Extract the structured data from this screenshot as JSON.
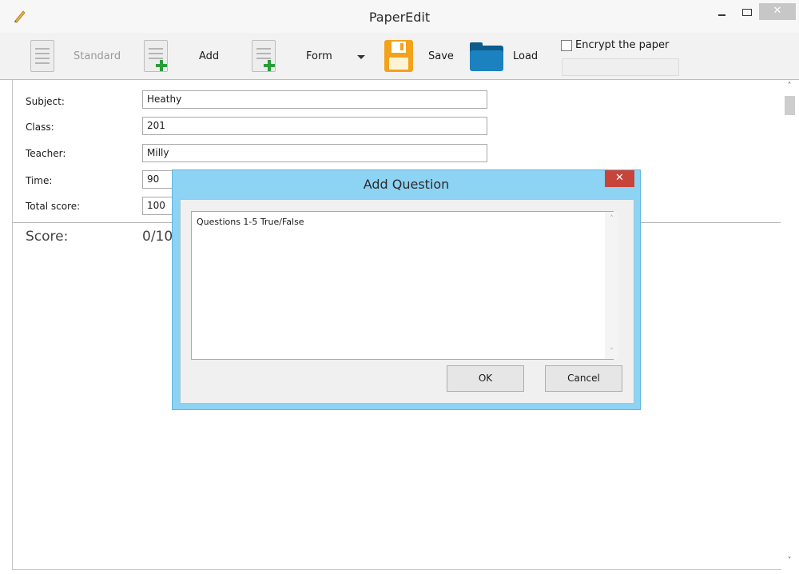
{
  "window": {
    "title": "PaperEdit",
    "minimize_icon": "minimize-icon",
    "maximize_icon": "maximize-icon",
    "close_glyph": "✕"
  },
  "toolbar": {
    "standard_label": "Standard",
    "add_label": "Add",
    "form_label": "Form",
    "save_label": "Save",
    "load_label": "Load",
    "encrypt_label": "Encrypt the paper",
    "encrypt_checked": false,
    "password_value": ""
  },
  "form": {
    "fields": [
      {
        "label": "Subject:",
        "value": "Heathy"
      },
      {
        "label": "Class:",
        "value": "201"
      },
      {
        "label": "Teacher:",
        "value": "Milly"
      },
      {
        "label": "Time:",
        "value": "90"
      },
      {
        "label": "Total score:",
        "value": "100"
      }
    ],
    "score_label": "Score:",
    "score_value": "0/10"
  },
  "dialog": {
    "title": "Add Question",
    "close_glyph": "✕",
    "text": "Questions 1-5 True/False",
    "ok_label": "OK",
    "cancel_label": "Cancel"
  },
  "scrollbar": {
    "up_glyph": "˄",
    "down_glyph": "˅"
  }
}
